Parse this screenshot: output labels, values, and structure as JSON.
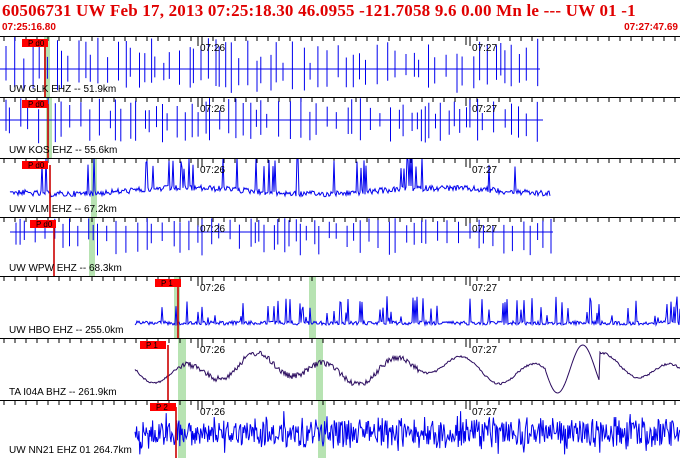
{
  "header": {
    "title": "60506731 UW Feb 17, 2013 07:25:18.30   46.0955 -121.7058  9.6 0.00 Mn le --- UW 01  -1",
    "start_time": "07:25:16.80",
    "end_time": "07:27:47.69"
  },
  "colors": {
    "header_text": "#e00000",
    "trace": "#0000ee",
    "trace_dark": "#2a0a5e",
    "pick_bg": "#ff0000",
    "pick_line": "#cc0000",
    "s_pick_band": "#b7e3b2",
    "tick": "#000000"
  },
  "panels": [
    {
      "station": "UW GLK EHZ -- 51.9km",
      "pick_label": "P d0",
      "minute_labels": [
        "07:26",
        "07:27"
      ],
      "trace_end_label": "",
      "style": "spiky",
      "color_key": "trace"
    },
    {
      "station": "UW KOS EHZ -- 55.6km",
      "pick_label": "P d0",
      "minute_labels": [
        "07:26",
        "07:27"
      ],
      "style": "spiky",
      "color_key": "trace"
    },
    {
      "station": "UW VLM EHZ -- 67.2km",
      "pick_label": "P d0",
      "minute_labels": [
        "07:26",
        "07:27"
      ],
      "style": "noisy",
      "color_key": "trace"
    },
    {
      "station": "UW WPW EHZ -- 68.3km",
      "pick_label": "P d0",
      "minute_labels": [
        "07:26",
        "07:27"
      ],
      "style": "spiky",
      "color_key": "trace"
    },
    {
      "station": "UW HBO EHZ -- 255.0km",
      "pick_label": "P 1",
      "minute_labels": [
        "07:26",
        "07:27"
      ],
      "style": "quiet",
      "color_key": "trace"
    },
    {
      "station": "TA I04A BHZ -- 261.9km",
      "pick_label": "P 1",
      "minute_labels": [
        "07:26",
        "07:27"
      ],
      "style": "wavy",
      "color_key": "trace_dark"
    },
    {
      "station": "UW NN21 EHZ 01 264.7km",
      "pick_label": "P 2",
      "minute_labels": [
        "07:26",
        "07:27"
      ],
      "style": "dense",
      "color_key": "trace"
    }
  ]
}
